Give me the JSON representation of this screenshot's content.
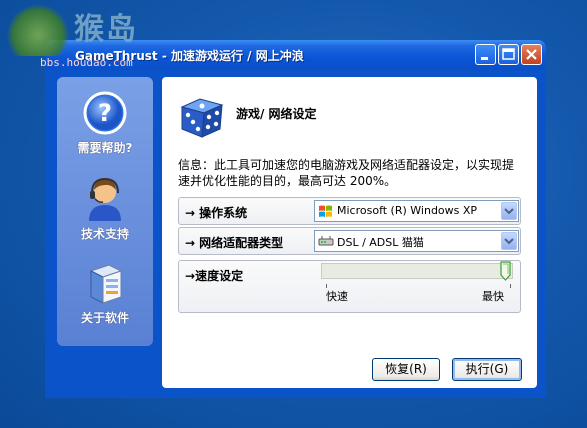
{
  "watermark": {
    "site": "猴岛",
    "url": "bbs.houdao.com"
  },
  "window": {
    "title": "GameThrust - 加速游戏运行 / 网上冲浪"
  },
  "sidebar": {
    "items": [
      {
        "label": "需要帮助?",
        "icon": "help-question-icon"
      },
      {
        "label": "技术支持",
        "icon": "support-agent-icon"
      },
      {
        "label": "关于软件",
        "icon": "about-software-icon"
      }
    ]
  },
  "main": {
    "heading": "游戏/ 网络设定",
    "info": "信息：此工具可加速您的电脑游戏及网络适配器设定，以实现提速并优化性能的目的，最高可达 200%。",
    "os": {
      "label": "操作系统",
      "value": "Microsoft (R) Windows XP",
      "icon": "windows-logo-icon"
    },
    "adapter": {
      "label": "网络适配器类型",
      "value": "DSL / ADSL 猫猫",
      "icon": "modem-icon"
    },
    "speed": {
      "label": "速度设定",
      "min_label": "快速",
      "max_label": "最快",
      "level": 1.0
    },
    "buttons": {
      "restore": "恢复(R)",
      "run": "执行(G)"
    }
  },
  "colors": {
    "titlebar": "#0a55d6",
    "sidebar": "#6b8fdd",
    "desktop": "#0a4e9c"
  }
}
